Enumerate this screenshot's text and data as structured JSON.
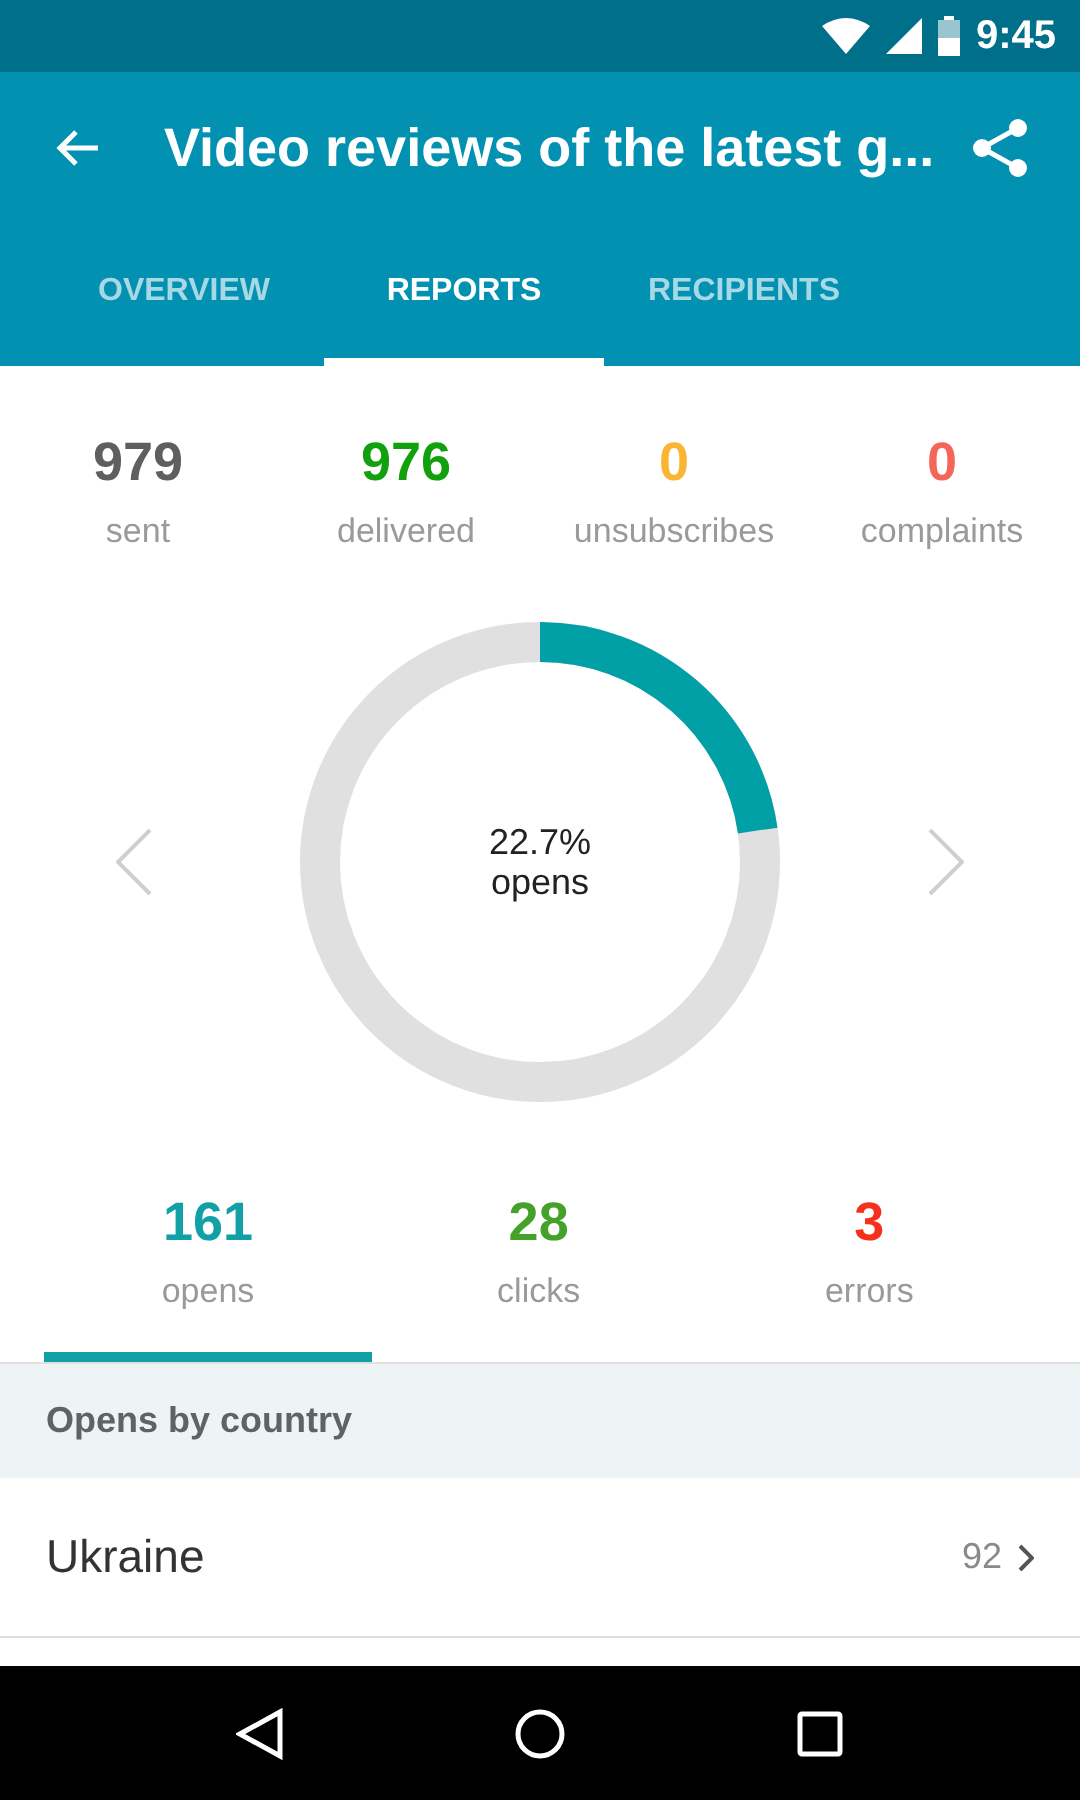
{
  "status_bar": {
    "time": "9:45"
  },
  "toolbar": {
    "title": "Video reviews of the latest g..."
  },
  "tabs": [
    {
      "label": "OVERVIEW",
      "selected": false
    },
    {
      "label": "REPORTS",
      "selected": true
    },
    {
      "label": "RECIPIENTS",
      "selected": false
    }
  ],
  "summary": [
    {
      "value": "979",
      "label": "sent",
      "color": "#5f5f5f"
    },
    {
      "value": "976",
      "label": "delivered",
      "color": "#12a10e"
    },
    {
      "value": "0",
      "label": "unsubscribes",
      "color": "#fbb534"
    },
    {
      "value": "0",
      "label": "complaints",
      "color": "#f4655a"
    }
  ],
  "ring": {
    "level": 0.227,
    "percent": "22.7%",
    "label": "opens"
  },
  "metric_tabs": [
    {
      "value": "161",
      "label": "opens",
      "color": "#12a0a7",
      "selected": true
    },
    {
      "value": "28",
      "label": "clicks",
      "color": "#44a12a",
      "selected": false
    },
    {
      "value": "3",
      "label": "errors",
      "color": "#f4311c",
      "selected": false
    }
  ],
  "section": {
    "title": "Opens by country"
  },
  "countries": [
    {
      "name": "Ukraine",
      "count": "92"
    }
  ]
}
